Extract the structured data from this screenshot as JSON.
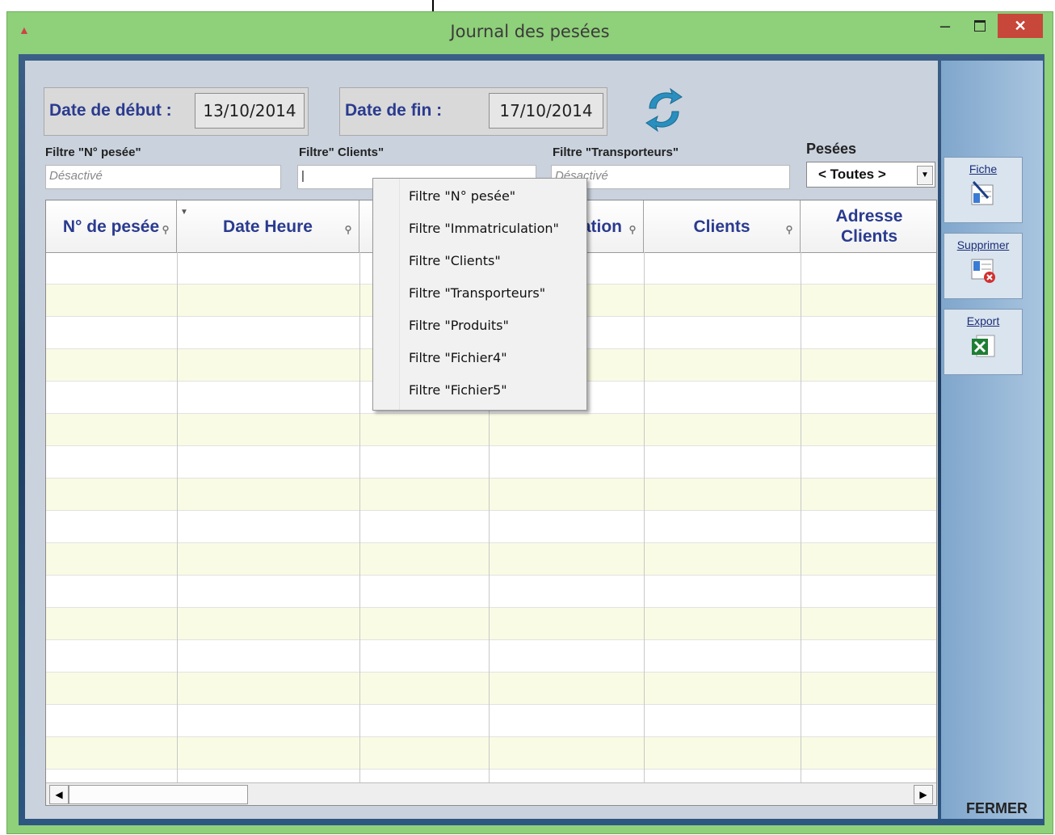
{
  "window": {
    "title": "Journal des pesées",
    "controls": {
      "minimize": "–",
      "close": "✕"
    }
  },
  "dates": {
    "start_label": "Date de début :",
    "start_value": "13/10/2014",
    "end_label": "Date de fin :",
    "end_value": "17/10/2014"
  },
  "filters": {
    "num_label": "Filtre \"N° pesée\"",
    "num_value": "Désactivé",
    "clients_label": "Filtre\" Clients\"",
    "clients_value": "|",
    "transporteurs_label": "Filtre \"Transporteurs\"",
    "transporteurs_value": "Désactivé",
    "pesees_label": "Pesées",
    "pesees_value": "< Toutes >"
  },
  "grid": {
    "columns": [
      "N° de pesée",
      "Date Heure",
      "",
      "ation",
      "Clients",
      "Adresse Clients"
    ]
  },
  "context_menu": {
    "items": [
      "Filtre \"N° pesée\"",
      "Filtre \"Immatriculation\"",
      "Filtre \"Clients\"",
      "Filtre \"Transporteurs\"",
      "Filtre \"Produits\"",
      "Filtre \"Fichier4\"",
      "Filtre \"Fichier5\""
    ]
  },
  "side_buttons": {
    "fiche": "Fiche",
    "supprimer": "Supprimer",
    "export": "Export"
  },
  "footer": {
    "close_label": "FERMER"
  },
  "colors": {
    "accent": "#2a3b8f",
    "title_bg": "#8fd07a",
    "close_btn": "#c7473a",
    "row_alt": "#fafbe4"
  }
}
